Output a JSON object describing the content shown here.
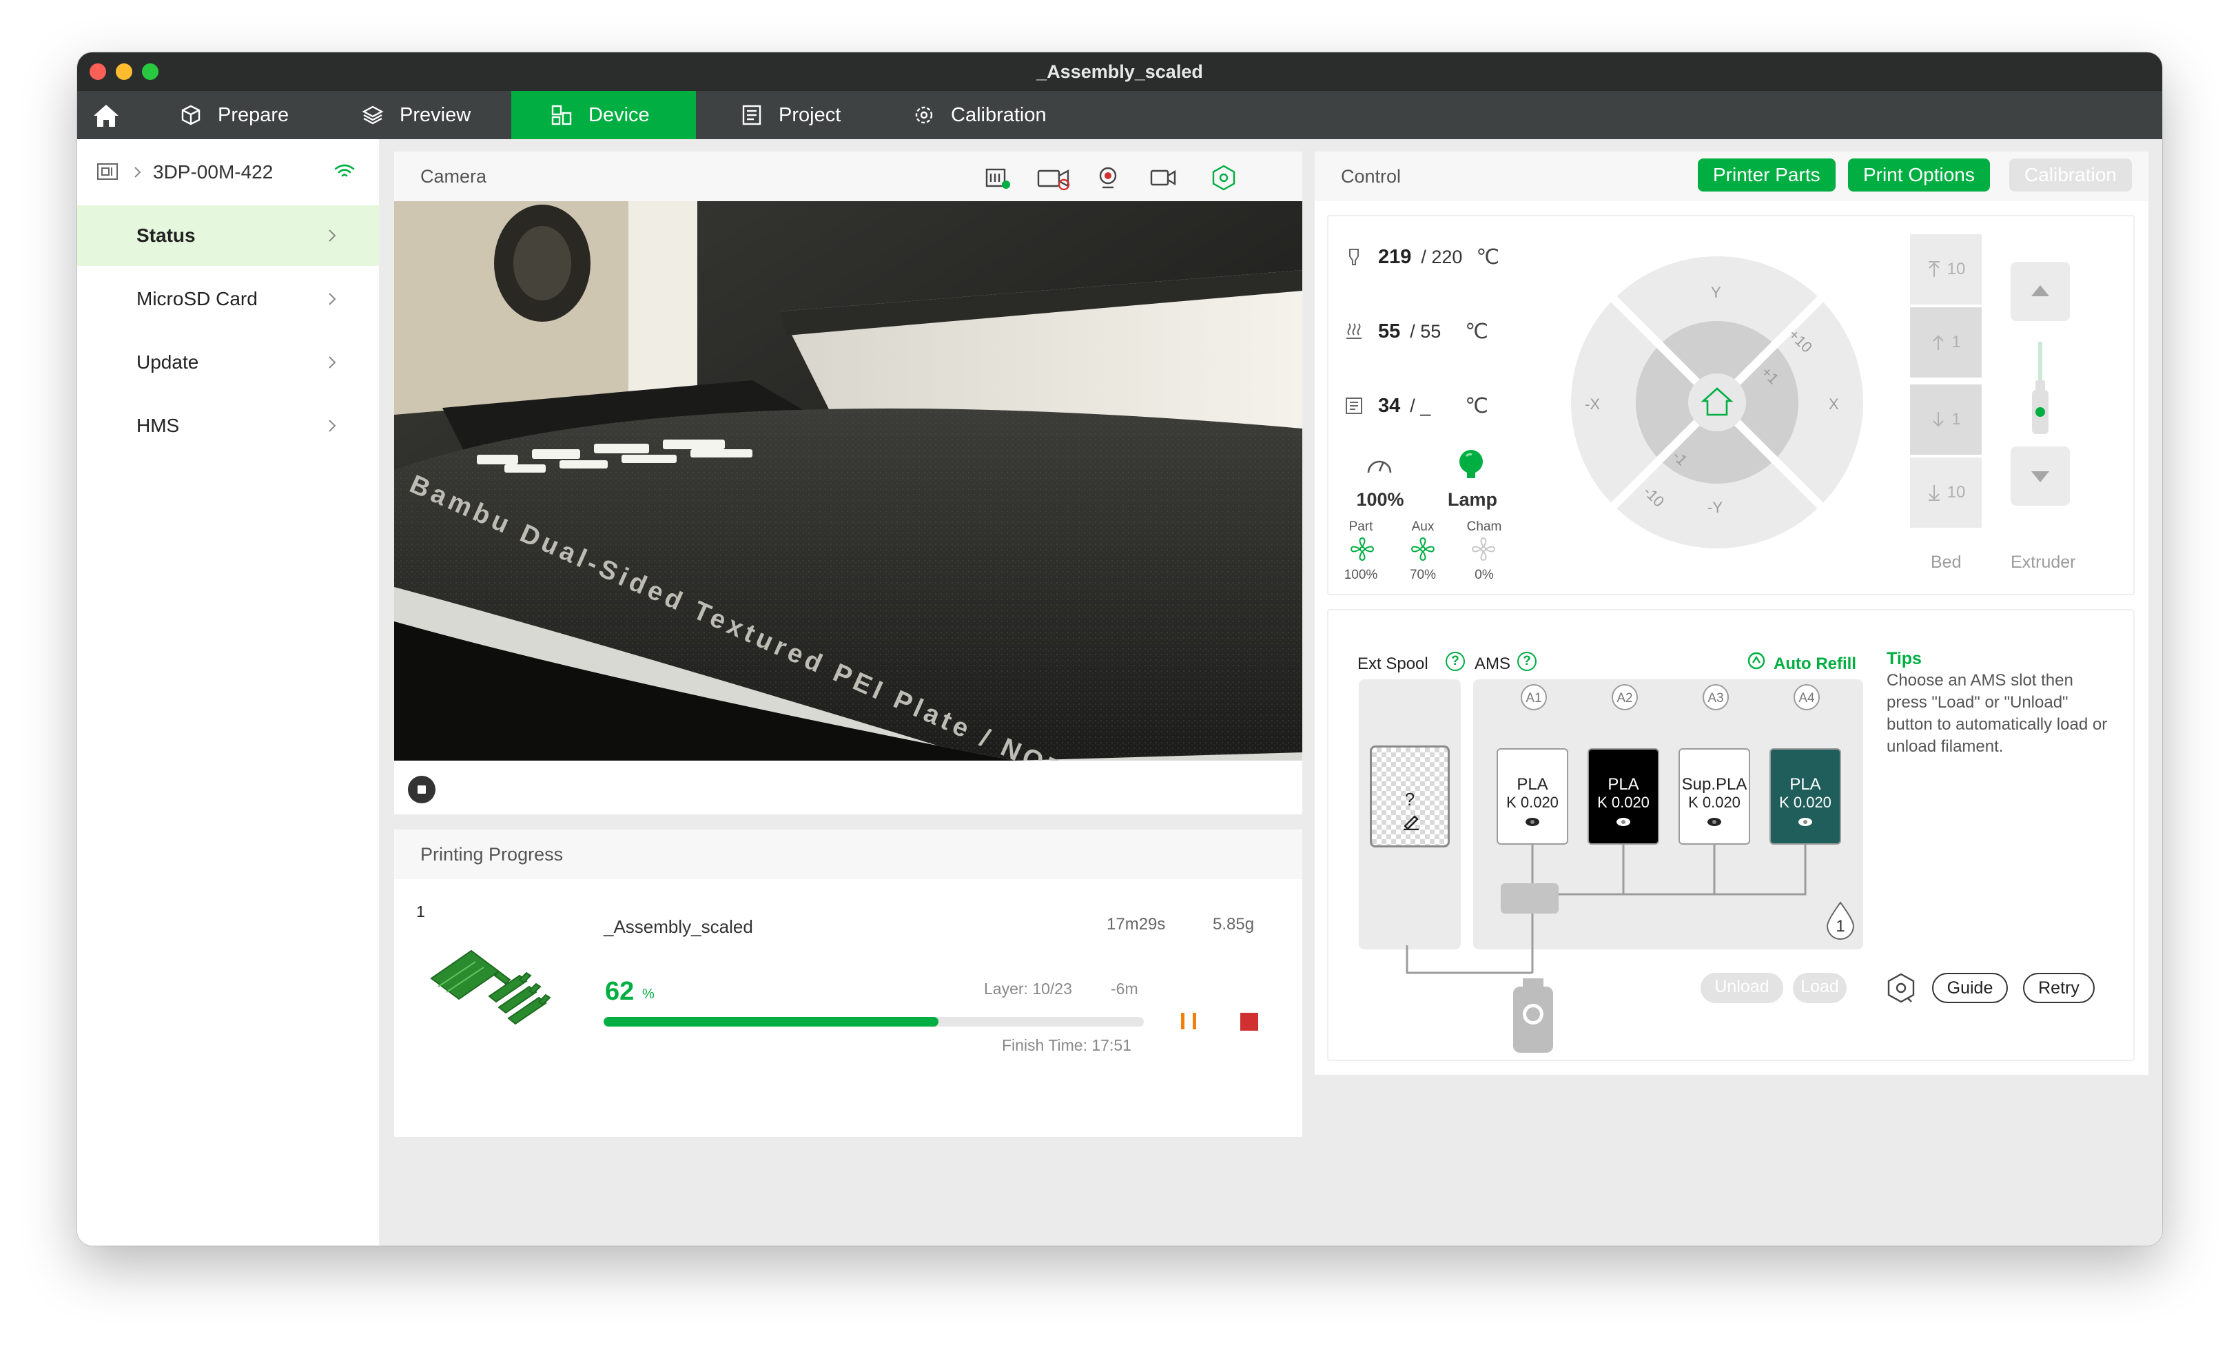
{
  "window": {
    "title": "_Assembly_scaled"
  },
  "nav": {
    "tabs": [
      {
        "label": "Prepare",
        "icon": "cube-icon"
      },
      {
        "label": "Preview",
        "icon": "layers-icon"
      },
      {
        "label": "Device",
        "icon": "device-icon"
      },
      {
        "label": "Project",
        "icon": "document-icon"
      },
      {
        "label": "Calibration",
        "icon": "calibration-icon"
      }
    ],
    "active_tab": "Device"
  },
  "sidebar": {
    "device_name": "3DP-00M-422",
    "items": [
      {
        "label": "Status"
      },
      {
        "label": "MicroSD Card"
      },
      {
        "label": "Update"
      },
      {
        "label": "HMS"
      }
    ],
    "active_item": "Status"
  },
  "camera": {
    "title": "Camera",
    "plate_text": "Bambu Dual-Sided Textured PEI Plate / NOT ADVISED FOR LIDAR"
  },
  "progress": {
    "title": "Printing Progress",
    "index": "1",
    "job_name": "_Assembly_scaled",
    "duration": "17m29s",
    "weight": "5.85g",
    "percent": "62",
    "percent_unit": "%",
    "percent_value": 0.62,
    "layer": "Layer: 10/23",
    "remaining": "-6m",
    "finish_time": "Finish Time: 17:51"
  },
  "control": {
    "title": "Control",
    "buttons": {
      "printer_parts": "Printer Parts",
      "print_options": "Print Options",
      "calibration": "Calibration"
    },
    "temps": [
      {
        "name": "nozzle",
        "current": "219",
        "target": "/ 220",
        "unit": "℃"
      },
      {
        "name": "bed",
        "current": "55",
        "target": "/ 55",
        "unit": "℃"
      },
      {
        "name": "chamber",
        "current": "34",
        "target": "/ _",
        "unit": "℃"
      }
    ],
    "speed": "100%",
    "lamp": "Lamp",
    "fans": [
      {
        "label": "Part",
        "value": "100%"
      },
      {
        "label": "Aux",
        "value": "70%"
      },
      {
        "label": "Cham",
        "value": "0%"
      }
    ],
    "jog": {
      "y": "Y",
      "neg_y": "-Y",
      "x": "X",
      "neg_x": "-X",
      "plus10": "+10",
      "plus1": "+1",
      "minus1": "-1",
      "minus10": "-10"
    },
    "bed": {
      "label": "Bed",
      "up10": "10",
      "up1": "1",
      "down1": "1",
      "down10": "10"
    },
    "extruder": {
      "label": "Extruder"
    }
  },
  "ams": {
    "ext_spool_label": "Ext Spool",
    "ams_label": "AMS",
    "auto_refill": "Auto Refill",
    "ext_slot": "?",
    "slots": [
      {
        "id": "A1",
        "material": "PLA",
        "k": "K 0.020",
        "color": "#ffffff",
        "text_color": "#222222"
      },
      {
        "id": "A2",
        "material": "PLA",
        "k": "K 0.020",
        "color": "#000000",
        "text_color": "#ffffff"
      },
      {
        "id": "A3",
        "material": "Sup.PLA",
        "k": "K 0.020",
        "color": "#ffffff",
        "text_color": "#222222"
      },
      {
        "id": "A4",
        "material": "PLA",
        "k": "K 0.020",
        "color": "#1f5e5b",
        "text_color": "#ffffff"
      }
    ],
    "unit_badge": "1",
    "tips_title": "Tips",
    "tips_text": "Choose an AMS slot then press \"Load\" or \"Unload\" button to automatically load or unload filament.",
    "buttons": {
      "unload": "Unload",
      "load": "Load",
      "guide": "Guide",
      "retry": "Retry"
    }
  }
}
